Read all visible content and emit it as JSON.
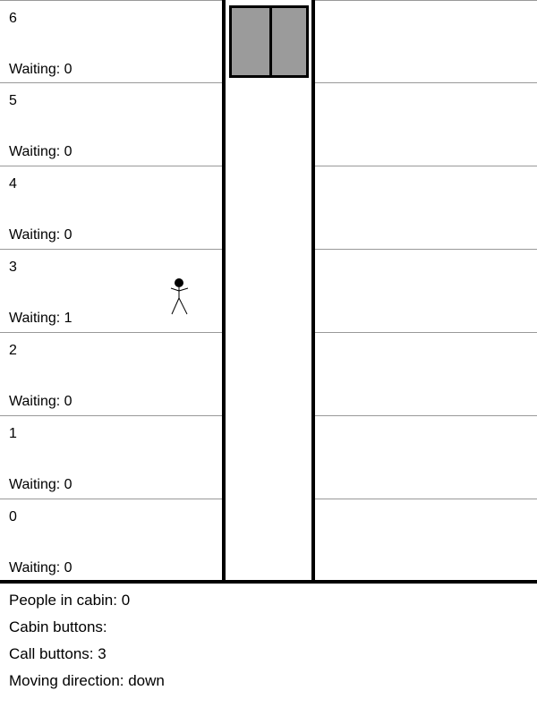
{
  "floors": [
    {
      "number": "6",
      "waiting": "Waiting: 0"
    },
    {
      "number": "5",
      "waiting": "Waiting: 0"
    },
    {
      "number": "4",
      "waiting": "Waiting: 0"
    },
    {
      "number": "3",
      "waiting": "Waiting: 1"
    },
    {
      "number": "2",
      "waiting": "Waiting: 0"
    },
    {
      "number": "1",
      "waiting": "Waiting: 0"
    },
    {
      "number": "0",
      "waiting": "Waiting: 0"
    }
  ],
  "status": {
    "people_in_cabin": "People in cabin: 0",
    "cabin_buttons": "Cabin buttons:",
    "call_buttons": "Call buttons: 3",
    "moving_direction": "Moving direction: down"
  },
  "colors": {
    "cabin": "#9b9b9b",
    "walls": "#000000",
    "floor_line": "#999999"
  },
  "icons": [
    "stick-figure-person-icon",
    "elevator-cabin-icon"
  ]
}
